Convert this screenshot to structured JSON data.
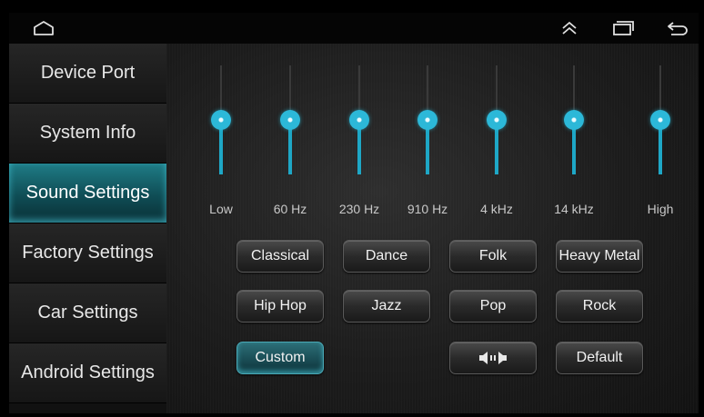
{
  "topbar": {
    "home_icon": "home-outline-icon",
    "collapse_icon": "double-chevron-up-icon",
    "recents_icon": "recents-icon",
    "back_icon": "back-arrow-icon"
  },
  "sidebar": {
    "items": [
      {
        "label": "Device Port"
      },
      {
        "label": "System Info"
      },
      {
        "label": "Sound Settings",
        "selected": true
      },
      {
        "label": "Factory Settings"
      },
      {
        "label": "Car Settings"
      },
      {
        "label": "Android Settings"
      }
    ]
  },
  "equalizer": {
    "bands": [
      {
        "label": "Low",
        "level": 0.5
      },
      {
        "label": "60 Hz",
        "level": 0.5
      },
      {
        "label": "230 Hz",
        "level": 0.5
      },
      {
        "label": "910 Hz",
        "level": 0.5
      },
      {
        "label": "4 kHz",
        "level": 0.5
      },
      {
        "label": "14 kHz",
        "level": 0.5
      },
      {
        "label": "High",
        "level": 0.5
      }
    ],
    "accent_color": "#1ea7c6"
  },
  "presets": {
    "row1": [
      "Classical",
      "Dance",
      "Folk",
      "Heavy Metal"
    ],
    "row2": [
      "Hip Hop",
      "Jazz",
      "Pop",
      "Rock"
    ],
    "custom": "Custom",
    "balance_icon": "speaker-balance-icon",
    "default": "Default",
    "selected": "Custom"
  }
}
